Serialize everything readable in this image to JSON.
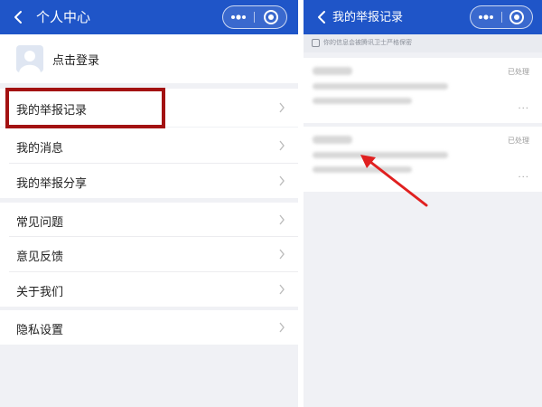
{
  "left": {
    "navbar": {
      "title": "个人中心"
    },
    "login_label": "点击登录",
    "menu": [
      {
        "label": "我的举报记录"
      },
      {
        "label": "我的消息"
      },
      {
        "label": "我的举报分享"
      },
      {
        "label": "常见问题"
      },
      {
        "label": "意见反馈"
      },
      {
        "label": "关于我们"
      },
      {
        "label": "隐私设置"
      }
    ]
  },
  "right": {
    "navbar": {
      "title": "我的举报记录"
    },
    "notice": "你的信息会被腾讯卫士严格保密",
    "records": [
      {
        "status": "已处理",
        "more": "···"
      },
      {
        "status": "已处理",
        "more": "···"
      }
    ]
  },
  "colors": {
    "navbar": "#1f55c8",
    "highlight_box": "#a31212",
    "arrow": "#e02020",
    "background": "#f0f1f5"
  },
  "icons": [
    "back-icon",
    "more-icon",
    "target-icon",
    "avatar-icon",
    "chevron-right-icon",
    "check-icon",
    "arrow-annotation"
  ]
}
